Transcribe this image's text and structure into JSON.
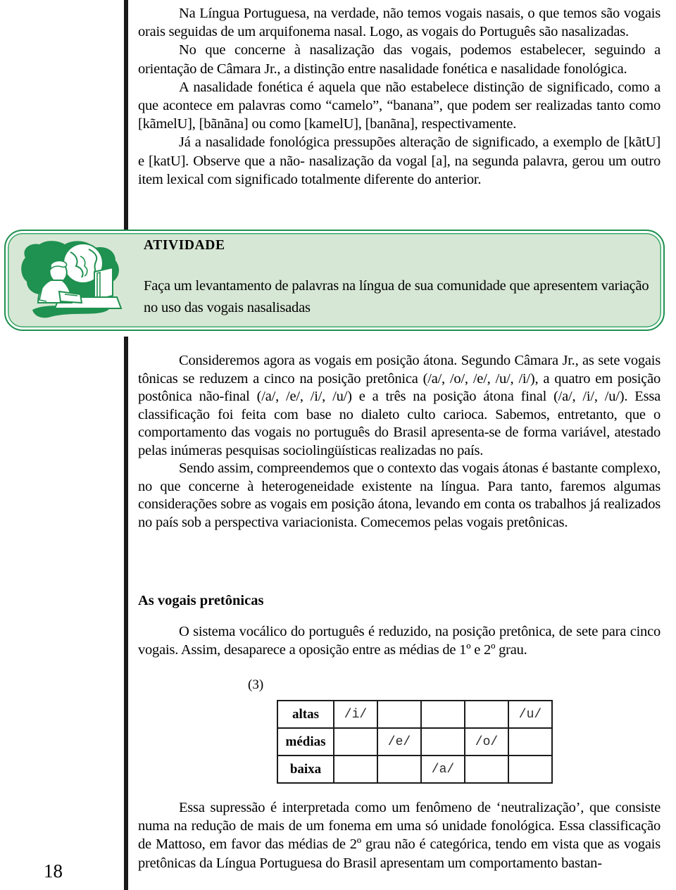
{
  "page": {
    "number": "18"
  },
  "top_paragraphs": [
    "Na Língua Portuguesa, na verdade, não temos vogais nasais, o que temos são vogais orais seguidas de um arquifonema nasal. Logo, as vogais do Português são nasalizadas.",
    "No que concerne à nasalização das vogais, podemos estabelecer, seguindo a orientação de Câmara Jr., a distinção entre nasalidade fonética e nasalidade fonológica.",
    "A nasalidade fonética é aquela que não estabelece distinção de significado, como a que acontece em palavras como “camelo”, “banana”, que podem ser realizadas tanto como [kãmelU], [bãnãna] ou como [kamelU], [banãna], respectivamente.",
    "Já a nasalidade fonológica pressupões alteração de significado, a exemplo de [kãtU] e [katU]. Observe que a não- nasalização da vogal [a], na segunda palavra, gerou um outro item lexical com significado totalmente diferente do anterior."
  ],
  "activity": {
    "title": "ATIVIDADE",
    "text": "Faça um levantamento de palavras na língua de sua comunidade que apresentem variação no uso das vogais nasalisadas",
    "icon_name": "computer-globe-illustration",
    "colors": {
      "fill": "#d7e7d5",
      "border": "#1f9150",
      "illustration_dark": "#1f9150",
      "illustration_light": "#ffffff"
    }
  },
  "middle_paragraphs": [
    "Consideremos agora as vogais em posição átona. Segundo Câmara Jr., as sete vogais tônicas se reduzem a cinco na posição pretônica (/a/, /o/, /e/, /u/, /i/), a quatro em posição postônica não-final (/a/, /e/, /i/, /u/) e a três na posição átona final (/a/, /i/, /u/). Essa classificação foi feita com base no dialeto culto carioca. Sabemos, entretanto, que o comportamento das vogais no português do Brasil apresenta-se de forma variável, atestado pelas inúmeras pesquisas sociolingüísticas realizadas no país.",
    "Sendo assim, compreendemos que o contexto das vogais átonas é bastante complexo, no que concerne à heterogeneidade existente na língua. Para tanto, faremos algumas considerações sobre as vogais em posição átona, levando em conta os trabalhos já realizados no país sob a perspectiva variacionista. Comecemos pelas vogais pretônicas."
  ],
  "section": {
    "heading": "As vogais pretônicas",
    "paragraph": "O sistema vocálico do português é reduzido, na posição pretônica, de sete para cinco vogais. Assim, desaparece a oposição entre as médias de 1º e 2º grau."
  },
  "example": {
    "label": "(3)",
    "table": {
      "rows": [
        {
          "label": "altas",
          "cells": [
            "/i/",
            "",
            "",
            "",
            "/u/"
          ]
        },
        {
          "label": "médias",
          "cells": [
            "",
            "/e/",
            "",
            "/o/",
            ""
          ]
        },
        {
          "label": "baixa",
          "cells": [
            "",
            "",
            "/a/",
            "",
            ""
          ]
        }
      ]
    }
  },
  "bottom_paragraph": "Essa supressão é interpretada como um fenômeno de ‘neutralização’, que consiste numa na redução de mais de um fonema em uma só unidade fonológica. Essa classificação de Mattoso, em favor das médias de 2º grau não é categórica, tendo em vista que as vogais pretônicas da Língua Portuguesa do Brasil apresentam um comportamento bastan-"
}
